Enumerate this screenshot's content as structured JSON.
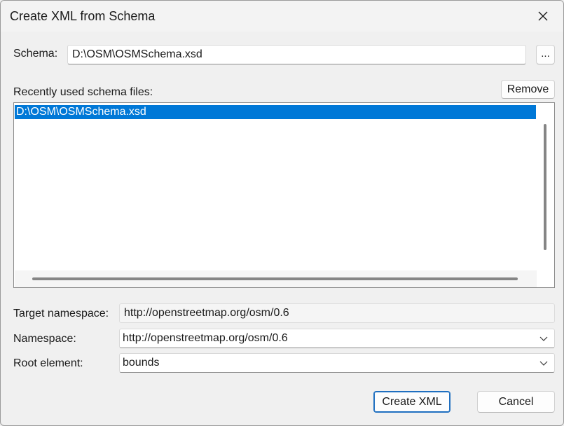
{
  "window": {
    "title": "Create XML from Schema",
    "close_icon": "close-icon"
  },
  "schema": {
    "label": "Schema:",
    "value": "D:\\OSM\\OSMSchema.xsd",
    "browse_label": "..."
  },
  "recent": {
    "label": "Recently used schema files:",
    "remove_label": "Remove",
    "items": [
      "D:\\OSM\\OSMSchema.xsd"
    ],
    "selected_index": 0
  },
  "target_namespace": {
    "label": "Target namespace:",
    "value": "http://openstreetmap.org/osm/0.6"
  },
  "namespace": {
    "label": "Namespace:",
    "value": "http://openstreetmap.org/osm/0.6"
  },
  "root_element": {
    "label": "Root element:",
    "value": "bounds"
  },
  "buttons": {
    "create_label": "Create XML",
    "cancel_label": "Cancel"
  },
  "colors": {
    "selection": "#0078d7",
    "default_button_border": "#1f6fc0"
  }
}
